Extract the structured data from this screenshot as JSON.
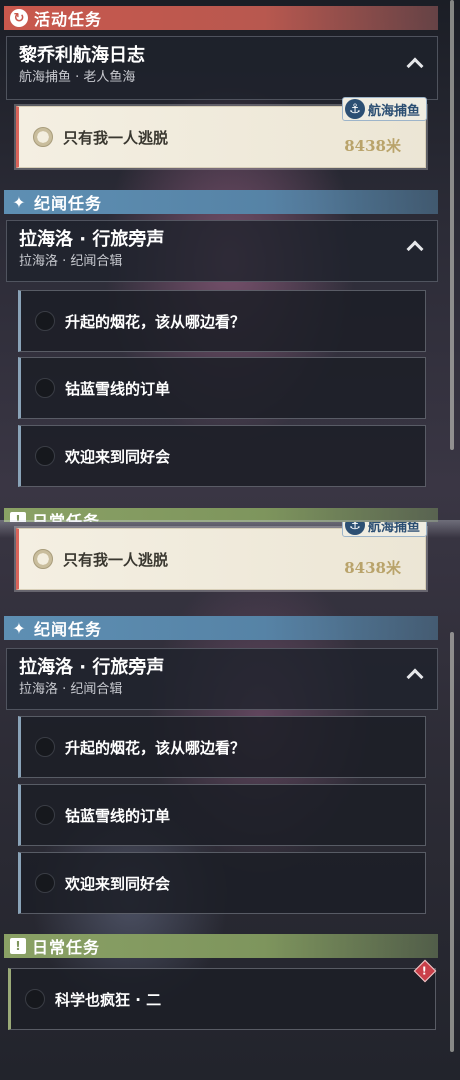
{
  "categories": {
    "activity": "活动任务",
    "lore": "纪闻任务",
    "daily": "日常任务"
  },
  "activity_chapter": {
    "title": "黎乔利航海日志",
    "subtitle": "航海捕鱼 · 老人鱼海"
  },
  "active_quest": {
    "name": "只有我一人逃脱",
    "distance": "8438米",
    "tag": "航海捕鱼"
  },
  "lore_chapter": {
    "title": "拉海洛 · 行旅旁声",
    "subtitle": "拉海洛 · 纪闻合辑"
  },
  "lore_quests": [
    {
      "name": "升起的烟花，该从哪边看？"
    },
    {
      "name": "钴蓝雪线的订单"
    },
    {
      "name": "欢迎来到同好会"
    }
  ],
  "daily_quests": [
    {
      "name": "科学也疯狂 · 二"
    }
  ],
  "icons": {
    "activity_category": "refresh-icon",
    "lore_category": "sparkle-icon",
    "daily_category": "exclamation-square-icon",
    "chevron": "chevron-up-icon",
    "tag": "anchor-icon",
    "alert": "alert-diamond-icon"
  },
  "colors": {
    "activity": "#c9584d",
    "lore": "#5e8fb3",
    "daily": "#8aa165",
    "distance": "#b9a36a",
    "tag": "#2c4f73"
  }
}
